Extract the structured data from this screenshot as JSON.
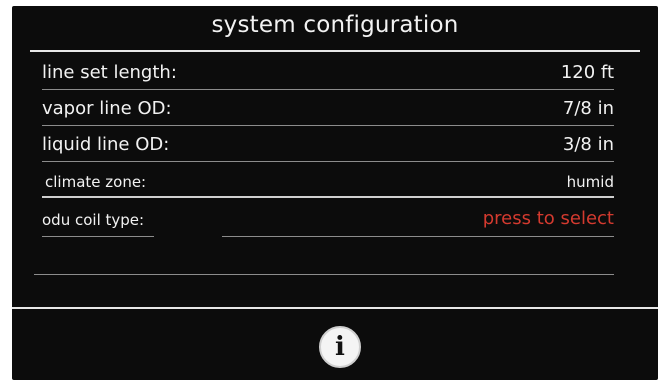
{
  "header": {
    "title": "system configuration"
  },
  "settings": [
    {
      "label": "line set length:",
      "value": "120 ft"
    },
    {
      "label": "vapor line OD:",
      "value": "7/8 in"
    },
    {
      "label": "liquid line OD:",
      "value": "3/8 in"
    },
    {
      "label": "climate zone:",
      "value": "humid"
    },
    {
      "label": "odu coil type:",
      "value": "press to select"
    }
  ],
  "footer": {
    "info_glyph": "i",
    "info_icon": "info-icon"
  },
  "colors": {
    "background": "#0c0c0c",
    "text": "#f2f2f2",
    "prompt": "#d43a2f"
  }
}
